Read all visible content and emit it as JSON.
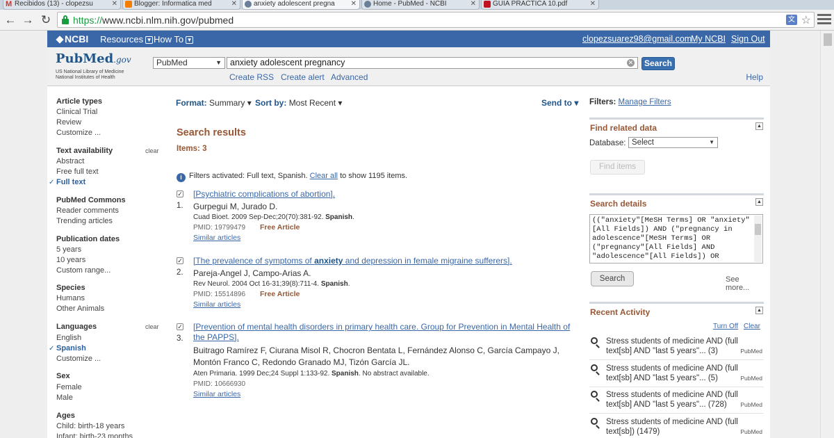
{
  "browser": {
    "tabs": [
      {
        "label": "Recibidos (13) - clopezsu"
      },
      {
        "label": "Blogger: Informatica med"
      },
      {
        "label": "anxiety adolescent pregna"
      },
      {
        "label": "Home - PubMed - NCBI"
      },
      {
        "label": "GUIA PRACTICA 10.pdf"
      }
    ],
    "url_scheme": "https://",
    "url_rest": "www.ncbi.nlm.nih.gov/pubmed"
  },
  "ncbi": {
    "logo": "NCBI",
    "resources": "Resources",
    "howto": "How To",
    "email": "clopezsuarez98@gmail.com",
    "my_ncbi": "My NCBI",
    "sign_out": "Sign Out"
  },
  "search": {
    "logo_pub": "PubMed",
    "logo_gov": ".gov",
    "logo_sub1": "US National Library of Medicine",
    "logo_sub2": "National Institutes of Health",
    "db": "PubMed",
    "query": "anxiety adolescent pregnancy ",
    "button": "Search",
    "create_rss": "Create RSS",
    "create_alert": "Create alert",
    "advanced": "Advanced",
    "help": "Help"
  },
  "sidebar": {
    "article_types": {
      "title": "Article types",
      "items": [
        "Clinical Trial",
        "Review",
        "Customize ..."
      ]
    },
    "text_availability": {
      "title": "Text availability",
      "clear": "clear",
      "items": [
        "Abstract",
        "Free full text",
        "Full text"
      ]
    },
    "pubmed_commons": {
      "title": "PubMed Commons",
      "items": [
        "Reader comments",
        "Trending articles"
      ]
    },
    "pub_dates": {
      "title": "Publication dates",
      "items": [
        "5 years",
        "10 years",
        "Custom range..."
      ]
    },
    "species": {
      "title": "Species",
      "items": [
        "Humans",
        "Other Animals"
      ]
    },
    "languages": {
      "title": "Languages",
      "clear": "clear",
      "items": [
        "English",
        "Spanish",
        "Customize ..."
      ]
    },
    "sex": {
      "title": "Sex",
      "items": [
        "Female",
        "Male"
      ]
    },
    "ages": {
      "title": "Ages",
      "items": [
        "Child: birth-18 years",
        "Infant: birth-23 months"
      ]
    }
  },
  "results": {
    "format_label": "Format:",
    "format_value": "Summary",
    "sort_label": "Sort by:",
    "sort_value": "Most Recent",
    "send_to": "Send to",
    "title": "Search results",
    "items": "Items: 3",
    "filters_text": "Filters activated: Full text, Spanish.",
    "clear_all": "Clear all",
    "show_text": "to show 1195 items.",
    "list": [
      {
        "num": "1.",
        "title": "[Psychiatric complications of abortion].",
        "authors": "Gurpegui M, Jurado D.",
        "cite_pre": "Cuad Bioet. 2009 Sep-Dec;20(70):381-92.",
        "lang": "Spanish",
        "cite_post": ".",
        "pmid": "PMID: 19799479",
        "free": "Free Article",
        "similar": "Similar articles"
      },
      {
        "num": "2.",
        "title_pre": "[The prevalence of symptoms of ",
        "title_hl": "anxiety",
        "title_post": " and depression in female migraine sufferers].",
        "authors": "Pareja-Angel J, Campo-Arias A.",
        "cite_pre": "Rev Neurol. 2004 Oct 16-31;39(8):711-4.",
        "lang": "Spanish",
        "cite_post": ".",
        "pmid": "PMID: 15514896",
        "free": "Free Article",
        "similar": "Similar articles"
      },
      {
        "num": "3.",
        "title": "[Prevention of mental health disorders in primary health care. Group for Prevention in Mental Health of the PAPPS].",
        "authors": "Buitrago Ramírez F, Ciurana Misol R, Chocron Bentata L, Fernández Alonso C, García Campayo J, Montón Franco C, Redondo Granado MJ, Tizón García JL.",
        "cite_pre": "Aten Primaria. 1999 Dec;24 Suppl 1:133-92.",
        "lang": "Spanish",
        "cite_post": ". No abstract available.",
        "pmid": "PMID: 10666930",
        "similar": "Similar articles"
      }
    ]
  },
  "right": {
    "filters_label": "Filters:",
    "manage_filters": "Manage Filters",
    "related_title": "Find related data",
    "db_label": "Database:",
    "db_value": "Select",
    "find_items": "Find items",
    "details_title": "Search details",
    "details_text": "((\"anxiety\"[MeSH Terms] OR \"anxiety\"[All Fields]) AND (\"pregnancy in adolescence\"[MeSH Terms] OR (\"pregnancy\"[All Fields] AND \"adolescence\"[All Fields]) OR",
    "details_search": "Search",
    "see_more": "See more...",
    "recent_title": "Recent Activity",
    "turn_off": "Turn Off",
    "clear": "Clear",
    "recent": [
      {
        "text": "Stress students of medicine AND (full text[sb] AND \"last 5 years\"... (3)",
        "src": "PubMed"
      },
      {
        "text": "Stress students of medicine AND (full text[sb] AND \"last 5 years\"... (5)",
        "src": "PubMed"
      },
      {
        "text": "Stress students of medicine AND (full text[sb] AND \"last 5 years\"... (728)",
        "src": "PubMed"
      },
      {
        "text": "Stress students of medicine AND (full text[sb]) (1479)",
        "src": "PubMed"
      }
    ]
  }
}
